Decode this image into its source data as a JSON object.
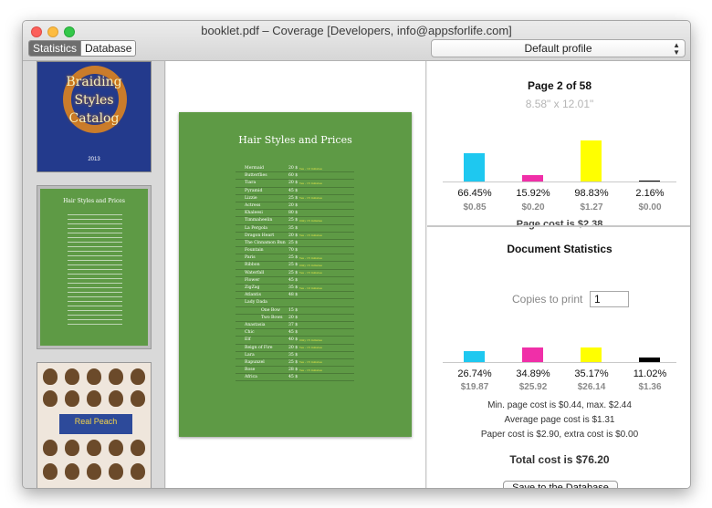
{
  "window": {
    "title": "booklet.pdf – Coverage [Developers, info@appsforlife.com]"
  },
  "toolbar": {
    "tabs": [
      {
        "label": "Statistics",
        "active": true
      },
      {
        "label": "Database",
        "active": false
      }
    ],
    "profile": "Default profile"
  },
  "thumbnails": {
    "cover": {
      "title_lines": [
        "Braiding",
        "Styles",
        "Catalog"
      ],
      "year": "2013"
    },
    "selected": {
      "title": "Hair Styles and Prices"
    },
    "photo": {
      "banner": "Real Peach"
    }
  },
  "preview": {
    "page_title": "Hair Styles and Prices",
    "rows": [
      {
        "name": "Mermaid",
        "price": "20 $",
        "tag": "Yes - 10 minutes"
      },
      {
        "name": "Butterflies",
        "price": "60 $",
        "tag": ""
      },
      {
        "name": "Tiara",
        "price": "20 $",
        "tag": "Yes - 15 minutes"
      },
      {
        "name": "Pyramid",
        "price": "45 $",
        "tag": ""
      },
      {
        "name": "Lizzie",
        "price": "25 $",
        "tag": "Yes - 15 minutes"
      },
      {
        "name": "Actress",
        "price": "20 $",
        "tag": ""
      },
      {
        "name": "Khaleesi",
        "price": "80 $",
        "tag": ""
      },
      {
        "name": "Timmaheelin",
        "price": "25 $",
        "tag": "Only 15 minutes"
      },
      {
        "name": "La Pergola",
        "price": "35 $",
        "tag": ""
      },
      {
        "name": "Dragon Heart",
        "price": "20 $",
        "tag": "Yes - 15 minutes"
      },
      {
        "name": "The Cinnamon Bun",
        "price": "25 $",
        "tag": ""
      },
      {
        "name": "Fountain",
        "price": "70 $",
        "tag": ""
      },
      {
        "name": "Paris",
        "price": "25 $",
        "tag": "Yes - 15 minutes"
      },
      {
        "name": "Ribbon",
        "price": "25 $",
        "tag": "Only 15 minutes"
      },
      {
        "name": "Waterfall",
        "price": "25 $",
        "tag": "Yes - 15 minutes"
      },
      {
        "name": "Flower",
        "price": "45 $",
        "tag": ""
      },
      {
        "name": "ZigZag",
        "price": "35 $",
        "tag": "Yes - 10 minutes"
      },
      {
        "name": "Atlantis",
        "price": "48 $",
        "tag": ""
      },
      {
        "name": "Lady Dada",
        "price": "",
        "tag": ""
      },
      {
        "name": "One Bow",
        "price": "15 $",
        "tag": "",
        "indent": true
      },
      {
        "name": "Two Bows",
        "price": "20 $",
        "tag": "",
        "indent": true
      },
      {
        "name": "Anastasia",
        "price": "37 $",
        "tag": ""
      },
      {
        "name": "Chic",
        "price": "45 $",
        "tag": ""
      },
      {
        "name": "Elf",
        "price": "40 $",
        "tag": "Only 15 minutes"
      },
      {
        "name": "Reign of Fire",
        "price": "20 $",
        "tag": "Yes - 15 minutes"
      },
      {
        "name": "Lara",
        "price": "35 $",
        "tag": ""
      },
      {
        "name": "Rapunzel",
        "price": "25 $",
        "tag": "Yes - 15 minutes"
      },
      {
        "name": "Rose",
        "price": "28 $",
        "tag": "Yes - 15 minutes"
      },
      {
        "name": "Africa",
        "price": "45 $",
        "tag": ""
      }
    ]
  },
  "page_stats": {
    "title": "Page 2 of 58",
    "dimensions": "8.58\" x 12.01\"",
    "inks": [
      {
        "name": "cyan",
        "color": "#1ec8f0",
        "percent": "66.45%",
        "percent_value": 66.45,
        "cost": "$0.85"
      },
      {
        "name": "magenta",
        "color": "#f02fa8",
        "percent": "15.92%",
        "percent_value": 15.92,
        "cost": "$0.20"
      },
      {
        "name": "yellow",
        "color": "#ffff00",
        "percent": "98.83%",
        "percent_value": 98.83,
        "cost": "$1.27"
      },
      {
        "name": "black",
        "color": "#000000",
        "percent": "2.16%",
        "percent_value": 2.16,
        "cost": "$0.00"
      }
    ],
    "page_cost": "Page cost is $2.38"
  },
  "document_stats": {
    "title": "Document Statistics",
    "copies_label": "Copies to print",
    "copies_value": "1",
    "inks": [
      {
        "name": "cyan",
        "color": "#1ec8f0",
        "percent": "26.74%",
        "percent_value": 26.74,
        "cost": "$19.87"
      },
      {
        "name": "magenta",
        "color": "#f02fa8",
        "percent": "34.89%",
        "percent_value": 34.89,
        "cost": "$25.92"
      },
      {
        "name": "yellow",
        "color": "#ffff00",
        "percent": "35.17%",
        "percent_value": 35.17,
        "cost": "$26.14"
      },
      {
        "name": "black",
        "color": "#000000",
        "percent": "11.02%",
        "percent_value": 11.02,
        "cost": "$1.36"
      }
    ],
    "min_max": "Min. page cost is $0.44, max. $2.44",
    "average": "Average page cost is $1.31",
    "paper": "Paper cost is $2.90, extra cost is $0.00",
    "total": "Total cost is $76.20",
    "save_button": "Save to the Database"
  }
}
